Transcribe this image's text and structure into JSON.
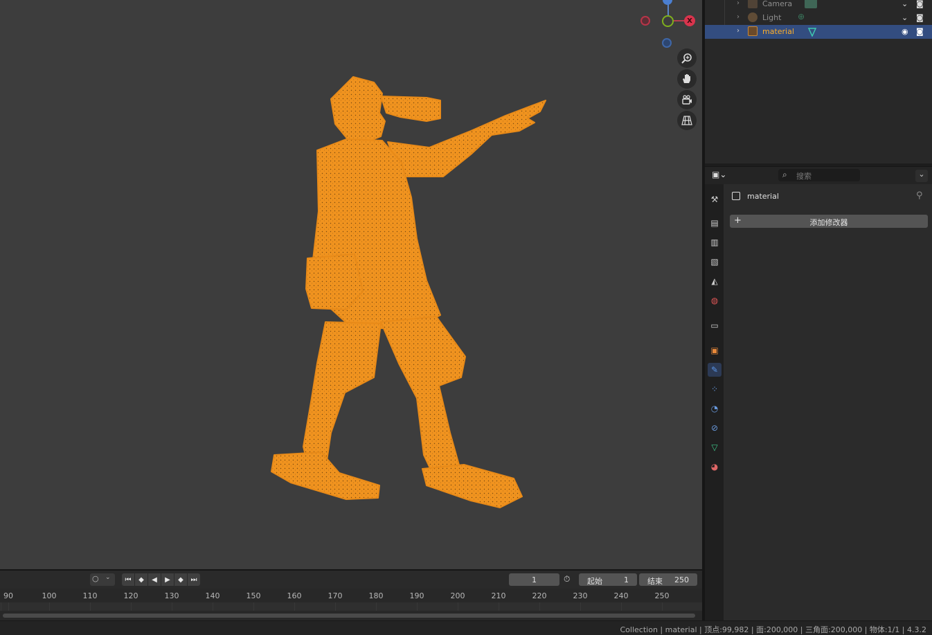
{
  "viewport": {
    "gizmo": {
      "x_label": "X"
    },
    "nav_icons": [
      "zoom-icon",
      "hand-pan-icon",
      "camera-view-icon",
      "ortho-grid-icon"
    ]
  },
  "outliner": {
    "rows": [
      {
        "name": "Camera",
        "icon": "camera-object-icon"
      },
      {
        "name": "Light",
        "icon": "light-object-icon"
      },
      {
        "name": "material",
        "icon": "mesh-object-icon",
        "selected": true
      }
    ],
    "colors": {
      "selected_row": "#334d80",
      "selected_text": "#ffaf29"
    }
  },
  "properties": {
    "search_placeholder": "搜索",
    "object_name": "material",
    "add_modifier_label": "添加修改器",
    "tabs": [
      "tool-icon",
      "render-icon",
      "output-icon",
      "view-layer-icon",
      "scene-icon",
      "world-icon",
      "collection-icon",
      "object-icon",
      "modifier-icon",
      "particles-icon",
      "physics-icon",
      "constraints-icon",
      "data-icon",
      "material-icon"
    ],
    "active_tab": "modifier-icon"
  },
  "timeline": {
    "current_frame": "1",
    "start_label": "起始",
    "start_value": "1",
    "end_label": "结束",
    "end_value": "250",
    "ticks": [
      "90",
      "100",
      "110",
      "120",
      "130",
      "140",
      "150",
      "160",
      "170",
      "180",
      "190",
      "200",
      "210",
      "220",
      "230",
      "240",
      "250"
    ]
  },
  "statusbar": {
    "text": "Collection | material | 顶点:99,982 | 面:200,000 | 三角面:200,000 | 物体:1/1 | 4.3.2"
  },
  "colors": {
    "viewport_bg": "#3d3d3d",
    "model_orange": "#f0931f",
    "accent_blue": "#4772b3"
  }
}
